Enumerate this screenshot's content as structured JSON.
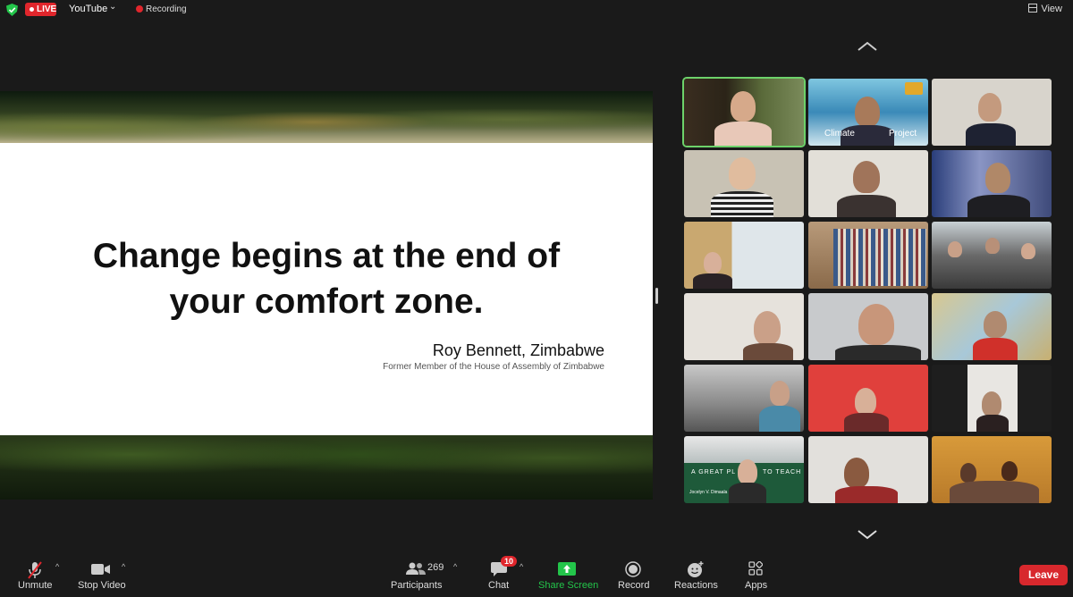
{
  "topbar": {
    "live": "LIVE",
    "stream_target": "YouTube",
    "recording": "Recording",
    "view": "View"
  },
  "slide": {
    "quote_line1": "Change begins at the end of",
    "quote_line2": "your comfort zone.",
    "author": "Roy Bennett, Zimbabwe",
    "author_title": "Former Member of the House of Assembly of Zimbabwe"
  },
  "gallery": {
    "tile2_text": "Climate",
    "tile2_text_b": "Project",
    "tile16_text_a": "A GREAT PL",
    "tile16_text_b": "TO TEACH",
    "tile16_name": "Jocelyn V. Dimaala"
  },
  "toolbar": {
    "unmute": "Unmute",
    "stop_video": "Stop Video",
    "participants_count": "269",
    "participants": "Participants",
    "chat_badge": "10",
    "chat": "Chat",
    "share_screen": "Share Screen",
    "record": "Record",
    "reactions": "Reactions",
    "apps": "Apps",
    "leave": "Leave"
  },
  "colors": {
    "live_red": "#e0262c",
    "share_green": "#23c54a",
    "active_speaker": "#6dd26a",
    "leave_red": "#d8282d"
  }
}
